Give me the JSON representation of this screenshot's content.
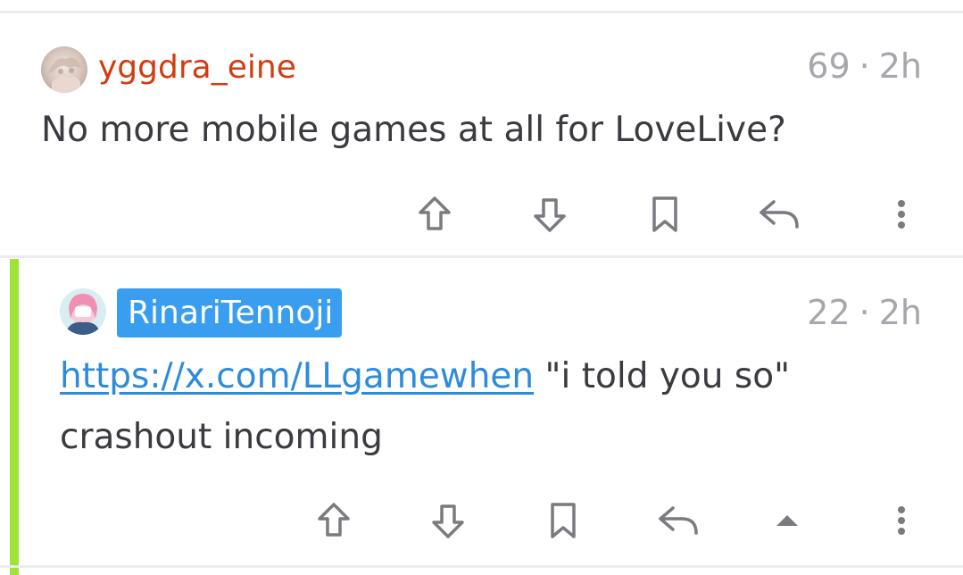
{
  "comments": [
    {
      "username": "yggdra_eine",
      "score": "69",
      "separator": "·",
      "age": "2h",
      "text": "No more mobile games at all for LoveLive?",
      "avatar_icon": "avatar-image",
      "username_color": "#d23c0f",
      "actions": [
        "upvote-icon",
        "downvote-icon",
        "bookmark-icon",
        "reply-icon",
        "more-options-icon"
      ]
    },
    {
      "username": "RinariTennoji",
      "username_badge_color": "#3a9ef0",
      "score": "22",
      "separator": "·",
      "age": "2h",
      "link_text": "https://x.com/LLgamewhen",
      "text_after_link": " \"i told you so\" crashout incoming",
      "avatar_icon": "avatar-image",
      "thread_color": "#9ee437",
      "actions": [
        "upvote-icon",
        "downvote-icon",
        "bookmark-icon",
        "reply-icon",
        "collapse-icon",
        "more-options-icon"
      ]
    }
  ],
  "colors": {
    "meta_text": "#a6a6ac",
    "body_text": "#3a3a40",
    "link": "#2e8bdc",
    "icon": "#7a7a80",
    "divider": "#ececf0"
  }
}
